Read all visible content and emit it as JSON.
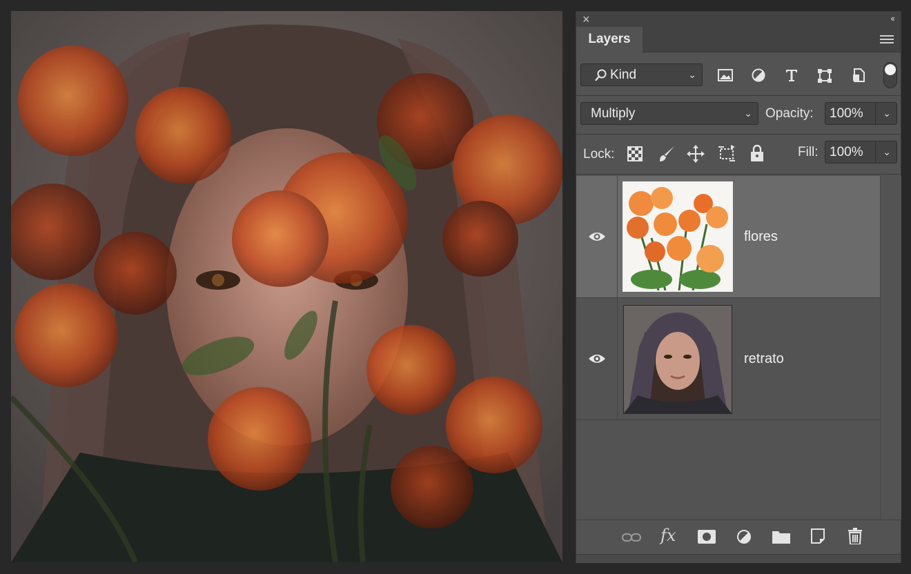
{
  "panel": {
    "title": "Layers",
    "close_glyph": "×",
    "collapse_glyph": "‹‹"
  },
  "filter": {
    "kind_label": "Kind",
    "icons": [
      "image-filter-icon",
      "adjustment-filter-icon",
      "type-filter-icon",
      "shape-filter-icon",
      "smart-object-filter-icon"
    ]
  },
  "blend": {
    "mode": "Multiply",
    "opacity_label": "Opacity:",
    "opacity_value": "100%"
  },
  "lock": {
    "label": "Lock:",
    "fill_label": "Fill:",
    "fill_value": "100%",
    "icons": [
      "lock-transparent-icon",
      "lock-image-icon",
      "lock-position-icon",
      "lock-artboard-icon",
      "lock-all-icon"
    ]
  },
  "layers": [
    {
      "name": "flores",
      "visible": true,
      "selected": true
    },
    {
      "name": "retrato",
      "visible": true,
      "selected": false
    }
  ],
  "bottom_icons": [
    "link-layers-icon",
    "fx-icon",
    "mask-icon",
    "adjustment-layer-icon",
    "group-folder-icon",
    "new-layer-icon",
    "trash-icon"
  ],
  "fx_glyph": "fx",
  "colors": {
    "panel_bg": "#535353",
    "selected_row": "#6b6b6b",
    "text": "#ececec"
  }
}
